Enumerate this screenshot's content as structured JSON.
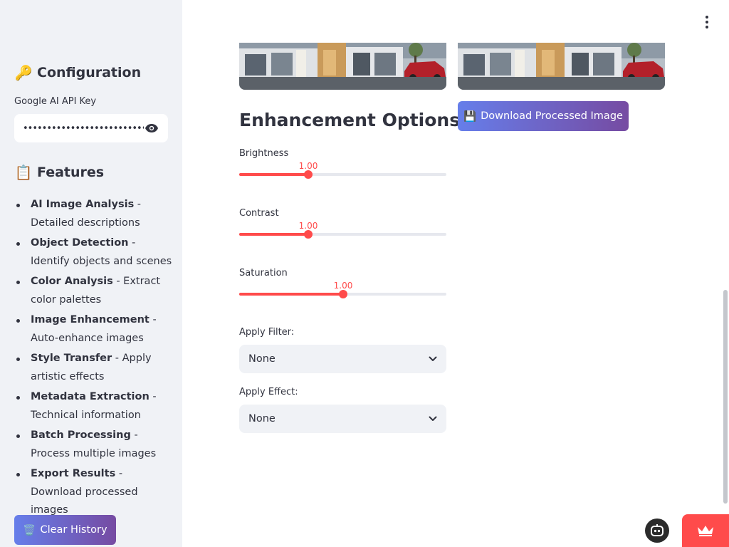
{
  "sidebar": {
    "config_emoji": "🔑",
    "config_title": "Configuration",
    "api_key_label": "Google AI API Key",
    "api_key_value": "••••••••••••••••••••••••••••••••••",
    "features_emoji": "📋",
    "features_title": "Features",
    "features": [
      {
        "name": "AI Image Analysis",
        "desc": " - Detailed descriptions"
      },
      {
        "name": "Object Detection",
        "desc": " - Identify objects and scenes"
      },
      {
        "name": "Color Analysis",
        "desc": " - Extract color palettes"
      },
      {
        "name": "Image Enhancement",
        "desc": " - Auto-enhance images"
      },
      {
        "name": "Style Transfer",
        "desc": " - Apply artistic effects"
      },
      {
        "name": "Metadata Extraction",
        "desc": " - Technical information"
      },
      {
        "name": "Batch Processing",
        "desc": " - Process multiple images"
      },
      {
        "name": "Export Results",
        "desc": " - Download processed images"
      }
    ],
    "clear_emoji": "🗑️",
    "clear_label": "Clear History"
  },
  "main": {
    "section_title": "Enhancement Options",
    "sliders": [
      {
        "label": "Brightness",
        "value_text": "1.00",
        "value": 1.0,
        "min": 0,
        "max": 3
      },
      {
        "label": "Contrast",
        "value_text": "1.00",
        "value": 1.0,
        "min": 0,
        "max": 3
      },
      {
        "label": "Saturation",
        "value_text": "1.00",
        "value": 1.0,
        "min": 0,
        "max": 2
      }
    ],
    "filter_label": "Apply Filter:",
    "filter_value": "None",
    "effect_label": "Apply Effect:",
    "effect_value": "None",
    "download_emoji": "💾",
    "download_label": "Download Processed Image"
  },
  "colors": {
    "accent": "#ff4b4b",
    "button_gradient_start": "#667eea",
    "button_gradient_end": "#764ba2",
    "sidebar_bg": "#f0f2f6",
    "text": "#31333f"
  },
  "icons": {
    "menu": "kebab-menu-icon",
    "eye": "eye-icon",
    "chevron": "chevron-down-icon",
    "bot": "bot-icon",
    "crown": "crown-icon"
  }
}
